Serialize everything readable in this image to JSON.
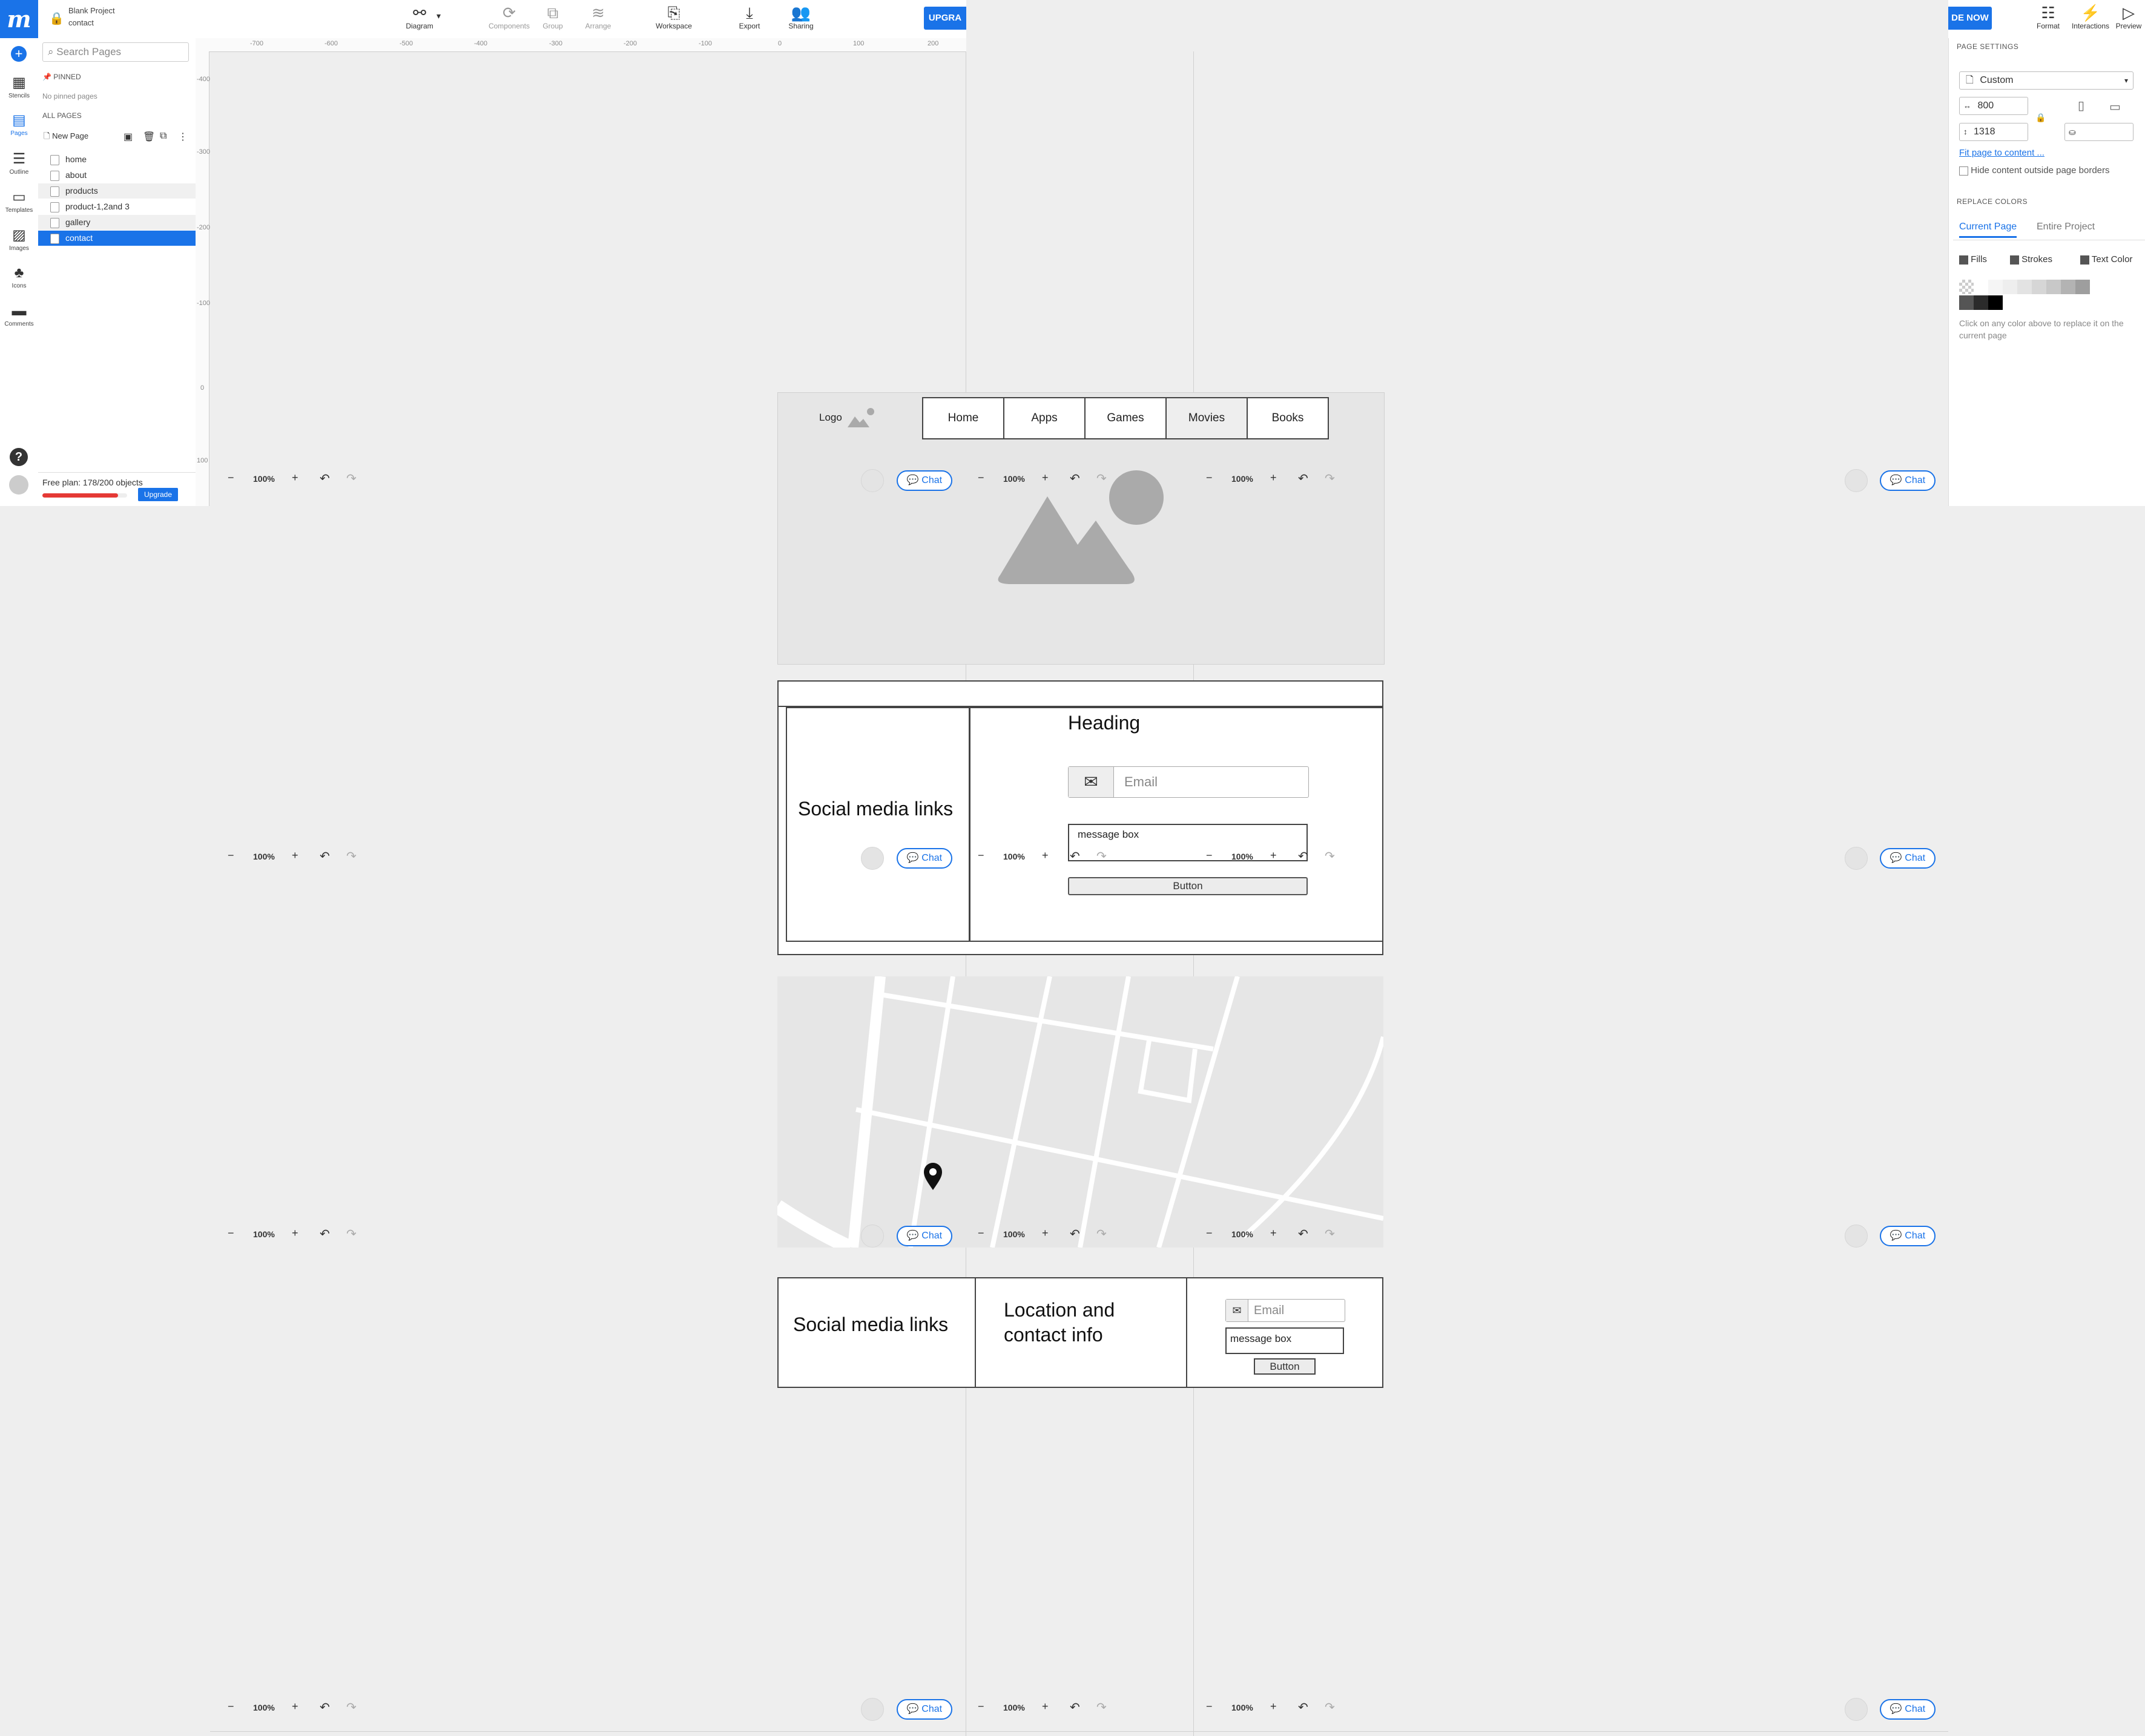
{
  "app": {
    "logo": "m",
    "project_name": "Blank Project",
    "page_name": "contact"
  },
  "rail": {
    "items": [
      {
        "label": "Stencils",
        "icon": "stencils-icon"
      },
      {
        "label": "Pages",
        "icon": "pages-icon"
      },
      {
        "label": "Outline",
        "icon": "outline-icon"
      },
      {
        "label": "Templates",
        "icon": "templates-icon"
      },
      {
        "label": "Images",
        "icon": "images-icon"
      },
      {
        "label": "Icons",
        "icon": "icons-icon"
      },
      {
        "label": "Comments",
        "icon": "comments-icon"
      }
    ]
  },
  "toolbar": {
    "diagram": "Diagram",
    "components": "Components",
    "group": "Group",
    "arrange": "Arrange",
    "workspace": "Workspace",
    "export": "Export",
    "sharing": "Sharing",
    "upgrade_left": "UPGRA",
    "upgrade_right": "DE NOW",
    "format": "Format",
    "interactions": "Interactions",
    "preview": "Preview"
  },
  "pages_panel": {
    "search_placeholder": "Search Pages",
    "pinned_label": "PINNED",
    "no_pinned": "No pinned pages",
    "all_pages_label": "ALL PAGES",
    "new_page": "New Page",
    "pages": [
      "home",
      "about",
      "products",
      "product-1,2and 3",
      "gallery",
      "contact"
    ],
    "selected_page": "contact",
    "plan_text": "Free plan: 178/200 objects",
    "plan_fraction": 0.89,
    "upgrade": "Upgrade"
  },
  "ruler": {
    "top_ticks": [
      "-700",
      "-600",
      "-500",
      "-400",
      "-300",
      "-200",
      "-100",
      "0",
      "100",
      "200"
    ],
    "left_ticks": [
      "-400",
      "-300",
      "-200",
      "-100",
      "0",
      "100"
    ]
  },
  "properties": {
    "page_settings_label": "PAGE SETTINGS",
    "size_preset": "Custom",
    "width": "800",
    "height": "1318",
    "fit_link": "Fit page to content ...",
    "hide_content_label": "Hide content outside page borders",
    "replace_colors_label": "REPLACE COLORS",
    "tabs": [
      "Current Page",
      "Entire Project"
    ],
    "fills": "Fills",
    "strokes": "Strokes",
    "text_color": "Text Color",
    "swatches": [
      "#ffffff",
      "#f5f5f5",
      "#eeeeee",
      "#e3e3e3",
      "#d6d6d6",
      "#c8c8c8",
      "#b3b3b3",
      "#9e9e9e",
      "#555555",
      "#2b2b2b",
      "#000000"
    ],
    "hint": "Click on any color above to replace it on the current page"
  },
  "canvas": {
    "zoom": "100%",
    "chat_label": "Chat",
    "wireframe": {
      "logo_text": "Logo",
      "nav": [
        "Home",
        "Apps",
        "Games",
        "Movies",
        "Books"
      ],
      "active_nav": "Movies",
      "social_links": "Social media links",
      "heading": "Heading",
      "email_placeholder": "Email",
      "message_box": "message box",
      "button": "Button",
      "footer_social": "Social media links",
      "location_line1": "Location and",
      "location_line2": "contact info",
      "footer_email": "Email",
      "footer_message": "message box",
      "footer_button": "Button"
    }
  }
}
